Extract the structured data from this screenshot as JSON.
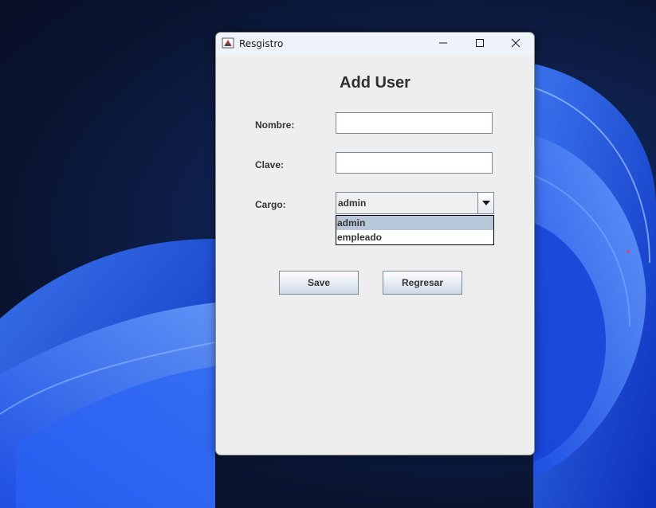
{
  "window": {
    "title": "Resgistro",
    "app_icon": "java-app-icon"
  },
  "title_buttons": {
    "minimize": "minimize-icon",
    "maximize": "maximize-icon",
    "close": "close-icon"
  },
  "form": {
    "heading": "Add User",
    "nombre_label": "Nombre:",
    "nombre_value": "",
    "clave_label": "Clave:",
    "clave_value": "",
    "cargo_label": "Cargo:",
    "cargo_selected": "admin",
    "cargo_options": [
      "admin",
      "empleado"
    ],
    "cargo_highlighted": "admin"
  },
  "buttons": {
    "save_label": "Save",
    "regresar_label": "Regresar"
  },
  "colors": {
    "window_bg": "#eeeeee",
    "selection_bg": "#b8c7d9",
    "accent_wallpaper": "#1f5cff"
  }
}
